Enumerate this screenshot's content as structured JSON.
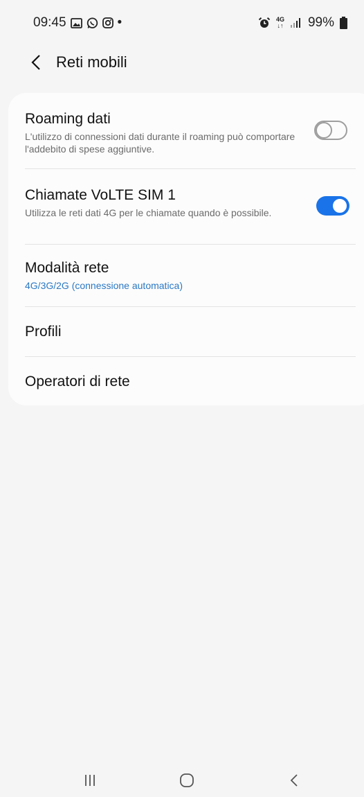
{
  "status_bar": {
    "time": "09:45",
    "dot": "•",
    "network_type": "4G",
    "battery": "99%",
    "icons": [
      "gallery-icon",
      "whatsapp-icon",
      "instagram-icon",
      "alarm-icon",
      "data-arrows-icon",
      "signal-icon",
      "battery-icon"
    ]
  },
  "header": {
    "title": "Reti mobili"
  },
  "settings": {
    "roaming": {
      "title": "Roaming dati",
      "subtitle": "L'utilizzo di connessioni dati durante il roaming può comportare l'addebito di spese aggiuntive.",
      "enabled": false
    },
    "volte": {
      "title": "Chiamate VoLTE SIM 1",
      "subtitle": "Utilizza le reti dati 4G per le chiamate quando è possibile.",
      "enabled": true
    },
    "network_mode": {
      "title": "Modalità rete",
      "value": "4G/3G/2G (connessione automatica)"
    },
    "profiles": {
      "title": "Profili"
    },
    "operators": {
      "title": "Operatori di rete"
    }
  },
  "colors": {
    "accent": "#1a73e8",
    "link": "#2a78c4",
    "background": "#f5f5f5",
    "card": "#fcfcfc"
  }
}
